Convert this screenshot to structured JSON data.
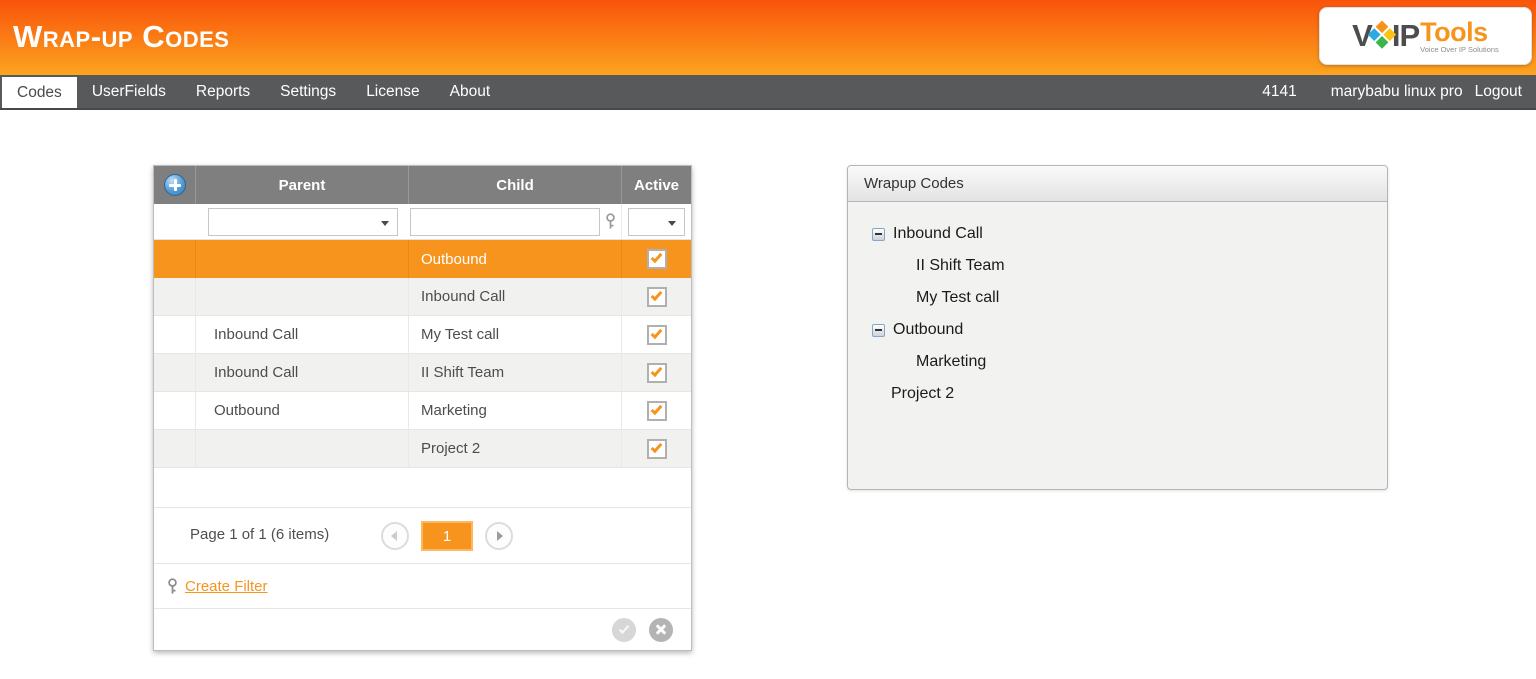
{
  "header": {
    "title": "Wrap-up Codes",
    "logo": {
      "v": "V",
      "ip": "IP",
      "tools": "Tools",
      "tagline": "Voice Over IP Solutions"
    }
  },
  "nav": {
    "items": [
      {
        "label": "Codes",
        "active": true
      },
      {
        "label": "UserFields",
        "active": false
      },
      {
        "label": "Reports",
        "active": false
      },
      {
        "label": "Settings",
        "active": false
      },
      {
        "label": "License",
        "active": false
      },
      {
        "label": "About",
        "active": false
      }
    ],
    "extension": "4141",
    "user": "marybabu linux pro",
    "logout_label": "Logout"
  },
  "grid": {
    "columns": {
      "parent": "Parent",
      "child": "Child",
      "active": "Active"
    },
    "filter_row": {
      "parent_filter_value": "",
      "child_filter_value": "",
      "active_filter_value": ""
    },
    "rows": [
      {
        "parent": "",
        "child": "Outbound",
        "active": true,
        "selected": true
      },
      {
        "parent": "",
        "child": "Inbound Call",
        "active": true,
        "selected": false
      },
      {
        "parent": "Inbound Call",
        "child": "My Test call",
        "active": true,
        "selected": false
      },
      {
        "parent": "Inbound Call",
        "child": "II Shift Team",
        "active": true,
        "selected": false
      },
      {
        "parent": "Outbound",
        "child": "Marketing",
        "active": true,
        "selected": false
      },
      {
        "parent": "",
        "child": "Project 2",
        "active": true,
        "selected": false
      }
    ],
    "pager": {
      "status": "Page 1 of 1 (6 items)",
      "current_page": "1"
    },
    "filter_bar": {
      "link_label": "Create Filter"
    }
  },
  "tree_panel": {
    "title": "Wrapup Codes",
    "nodes": [
      {
        "label": "Inbound Call",
        "expanded": true,
        "children": [
          "II Shift Team",
          "My Test call"
        ]
      },
      {
        "label": "Outbound",
        "expanded": true,
        "children": [
          "Marketing"
        ]
      },
      {
        "label": "Project 2",
        "expanded": false,
        "children": []
      }
    ]
  },
  "icons": {
    "add": "plus-circle-icon",
    "filter": "filter-key-icon",
    "prev": "chevron-left-icon",
    "next": "chevron-right-icon",
    "apply": "check-circle-icon",
    "cancel": "x-circle-icon",
    "collapse": "minus-box-icon",
    "dropdown": "chevron-down-icon",
    "checkbox": "orange-check-icon"
  },
  "colors": {
    "accent_orange": "#F7941E",
    "header_gradient_top": "#F9530A",
    "header_gradient_bottom": "#FCA41F",
    "nav_gray": "#58595B",
    "grid_header_gray": "#7F7F7F",
    "row_alt": "#F1F1EF",
    "selected_row": "#F7941E"
  }
}
